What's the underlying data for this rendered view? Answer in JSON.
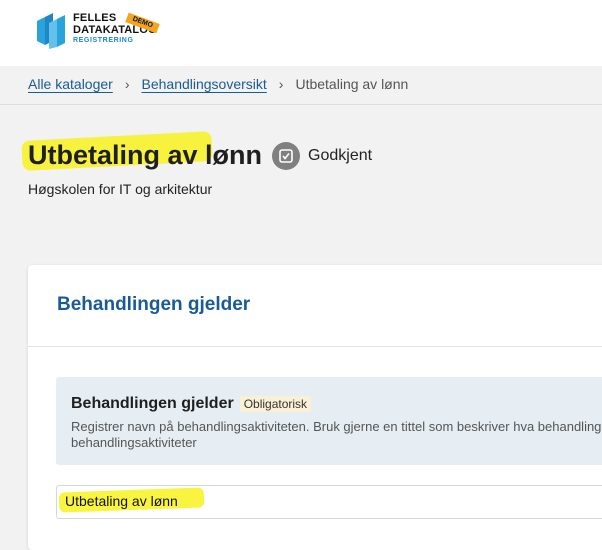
{
  "header": {
    "logo": {
      "line1": "FELLES",
      "line2": "DATAKATALOG",
      "line3": "REGISTRERING",
      "badge": "DEMO"
    }
  },
  "breadcrumb": {
    "items": [
      "Alle kataloger",
      "Behandlingsoversikt"
    ],
    "current": "Utbetaling av lønn",
    "separator": "›"
  },
  "page": {
    "title": "Utbetaling av lønn",
    "status": "Godkjent",
    "organization": "Høgskolen for IT og arkitektur"
  },
  "card": {
    "title": "Behandlingen gjelder",
    "field": {
      "label": "Behandlingen gjelder",
      "required": "Obligatorisk",
      "help_line1": "Registrer navn på behandlingsaktiviteten. Bruk gjerne en tittel som beskriver hva behandlingen",
      "help_line2": "behandlingsaktiviteter",
      "value": "Utbetaling av lønn"
    }
  },
  "colors": {
    "link": "#1a5b95",
    "highlight": "#f7f21f",
    "badge": "#f3a51d",
    "status_icon": "#808080"
  }
}
